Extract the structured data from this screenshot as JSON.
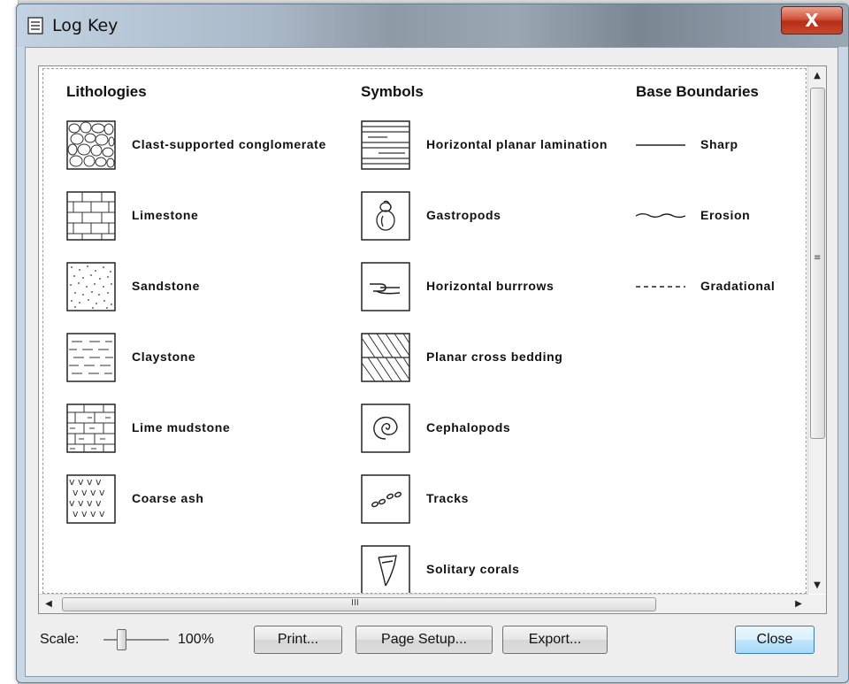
{
  "window": {
    "title": "Log Key",
    "close_glyph": "X"
  },
  "columns": {
    "lithologies": {
      "heading": "Lithologies",
      "items": [
        {
          "label": "Clast-supported conglomerate",
          "icon": "conglomerate-pattern-icon"
        },
        {
          "label": "Limestone",
          "icon": "limestone-pattern-icon"
        },
        {
          "label": "Sandstone",
          "icon": "sandstone-pattern-icon"
        },
        {
          "label": "Claystone",
          "icon": "claystone-pattern-icon"
        },
        {
          "label": "Lime mudstone",
          "icon": "lime-mudstone-pattern-icon"
        },
        {
          "label": "Coarse ash",
          "icon": "coarse-ash-pattern-icon"
        }
      ]
    },
    "symbols": {
      "heading": "Symbols",
      "items": [
        {
          "label": "Horizontal planar lamination",
          "icon": "planar-lamination-icon"
        },
        {
          "label": "Gastropods",
          "icon": "gastropod-icon"
        },
        {
          "label": "Horizontal burrrows",
          "icon": "burrow-icon"
        },
        {
          "label": "Planar cross bedding",
          "icon": "cross-bedding-icon"
        },
        {
          "label": "Cephalopods",
          "icon": "cephalopod-icon"
        },
        {
          "label": "Tracks",
          "icon": "tracks-icon"
        },
        {
          "label": "Solitary corals",
          "icon": "solitary-coral-icon"
        }
      ]
    },
    "base_boundaries": {
      "heading": "Base Boundaries",
      "items": [
        {
          "label": "Sharp",
          "icon": "sharp-line-icon"
        },
        {
          "label": "Erosion",
          "icon": "wavy-line-icon"
        },
        {
          "label": "Gradational",
          "icon": "dashed-line-icon"
        }
      ]
    }
  },
  "scrollbars": {
    "h_grip": "III",
    "v_grip": "≡"
  },
  "footer": {
    "scale_label": "Scale:",
    "scale_value": "100%",
    "scale_level_percent": 100,
    "print_button": "Print...",
    "page_setup_button": "Page Setup...",
    "export_button": "Export...",
    "close_button": "Close"
  }
}
